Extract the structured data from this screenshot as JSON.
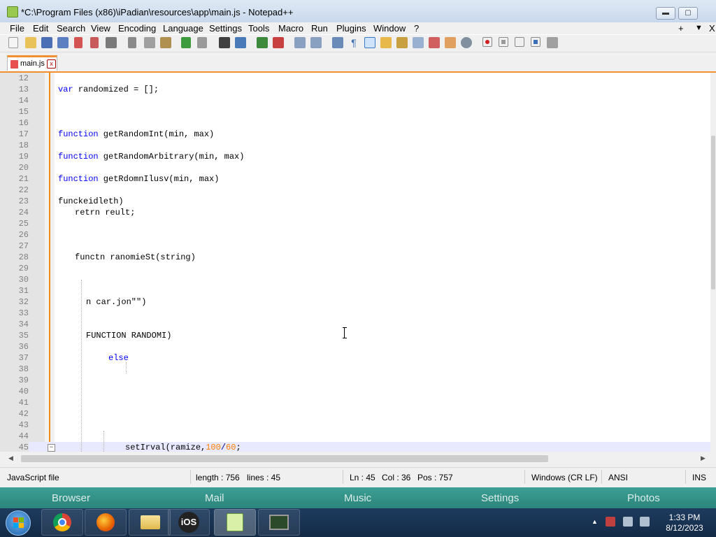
{
  "window": {
    "title": "*C:\\Program Files (x86)\\iPadian\\resources\\app\\main.js - Notepad++",
    "min_glyph": "▬",
    "max_glyph": "▢",
    "close_glyph": "✕"
  },
  "menu": {
    "items": [
      "File",
      "Edit",
      "Search",
      "View",
      "Encoding",
      "Language",
      "Settings",
      "Tools",
      "Macro",
      "Run",
      "Plugins",
      "Window",
      "?"
    ],
    "right_plus": "+",
    "right_arrow": "▼",
    "right_x": "X"
  },
  "tab": {
    "label": "main.js",
    "close_glyph": "x"
  },
  "editor": {
    "lines": [
      {
        "n": "12",
        "text": ""
      },
      {
        "n": "13",
        "kw": "var",
        "text": " randomized = [];"
      },
      {
        "n": "14",
        "text": ""
      },
      {
        "n": "15",
        "text": ""
      },
      {
        "n": "16",
        "text": ""
      },
      {
        "n": "17",
        "kw": "function",
        "text": " getRandomInt(min, max)"
      },
      {
        "n": "18",
        "text": ""
      },
      {
        "n": "19",
        "kw": "function",
        "text": " getRandomArbitrary(min, max)"
      },
      {
        "n": "20",
        "text": ""
      },
      {
        "n": "21",
        "kw": "function",
        "text": " getRdomnIlusv(min, max)"
      },
      {
        "n": "22",
        "text": ""
      },
      {
        "n": "23",
        "text": "funckeidleth)"
      },
      {
        "n": "24",
        "text": "retrn reult;"
      },
      {
        "n": "25",
        "text": ""
      },
      {
        "n": "26",
        "text": ""
      },
      {
        "n": "27",
        "text": ""
      },
      {
        "n": "28",
        "text": "functn ranomieSt(string)"
      },
      {
        "n": "29",
        "text": ""
      },
      {
        "n": "30",
        "text": ""
      },
      {
        "n": "31",
        "text": ""
      },
      {
        "n": "32",
        "text": "n car.jon\"\")"
      },
      {
        "n": "33",
        "text": ""
      },
      {
        "n": "34",
        "text": ""
      },
      {
        "n": "35",
        "text": "FUNCTION RANDOMI)"
      },
      {
        "n": "36",
        "text": ""
      },
      {
        "n": "37",
        "kw": "else",
        "text": ""
      },
      {
        "n": "38",
        "text": ""
      },
      {
        "n": "39",
        "text": ""
      },
      {
        "n": "40",
        "text": ""
      },
      {
        "n": "41",
        "text": ""
      },
      {
        "n": "42",
        "text": ""
      },
      {
        "n": "43",
        "text": ""
      },
      {
        "n": "44",
        "text": ""
      },
      {
        "n": "45",
        "pre": "setIrval(ramize,",
        "num1": "100",
        "slash": "/",
        "num2": "60",
        "post": ";"
      }
    ]
  },
  "status": {
    "file_type": "JavaScript file",
    "length": "length : 756",
    "lines": "lines : 45",
    "ln": "Ln : 45",
    "col": "Col : 36",
    "pos": "Pos : 757",
    "eol": "Windows (CR LF)",
    "encoding": "ANSI",
    "mode": "INS"
  },
  "dock": {
    "items": [
      "Browser",
      "Mail",
      "Music",
      "Settings",
      "Photos"
    ]
  },
  "taskbar": {
    "ios_label": "iOS",
    "time": "1:33 PM",
    "date": "8/12/2023"
  },
  "colors": {
    "keyword": "#0000ff",
    "number": "#ff8000",
    "fold_line": "#f28a1a",
    "current_line": "#e8e8ff",
    "dock": "#2f8f85",
    "taskbar": "#1a3556"
  }
}
